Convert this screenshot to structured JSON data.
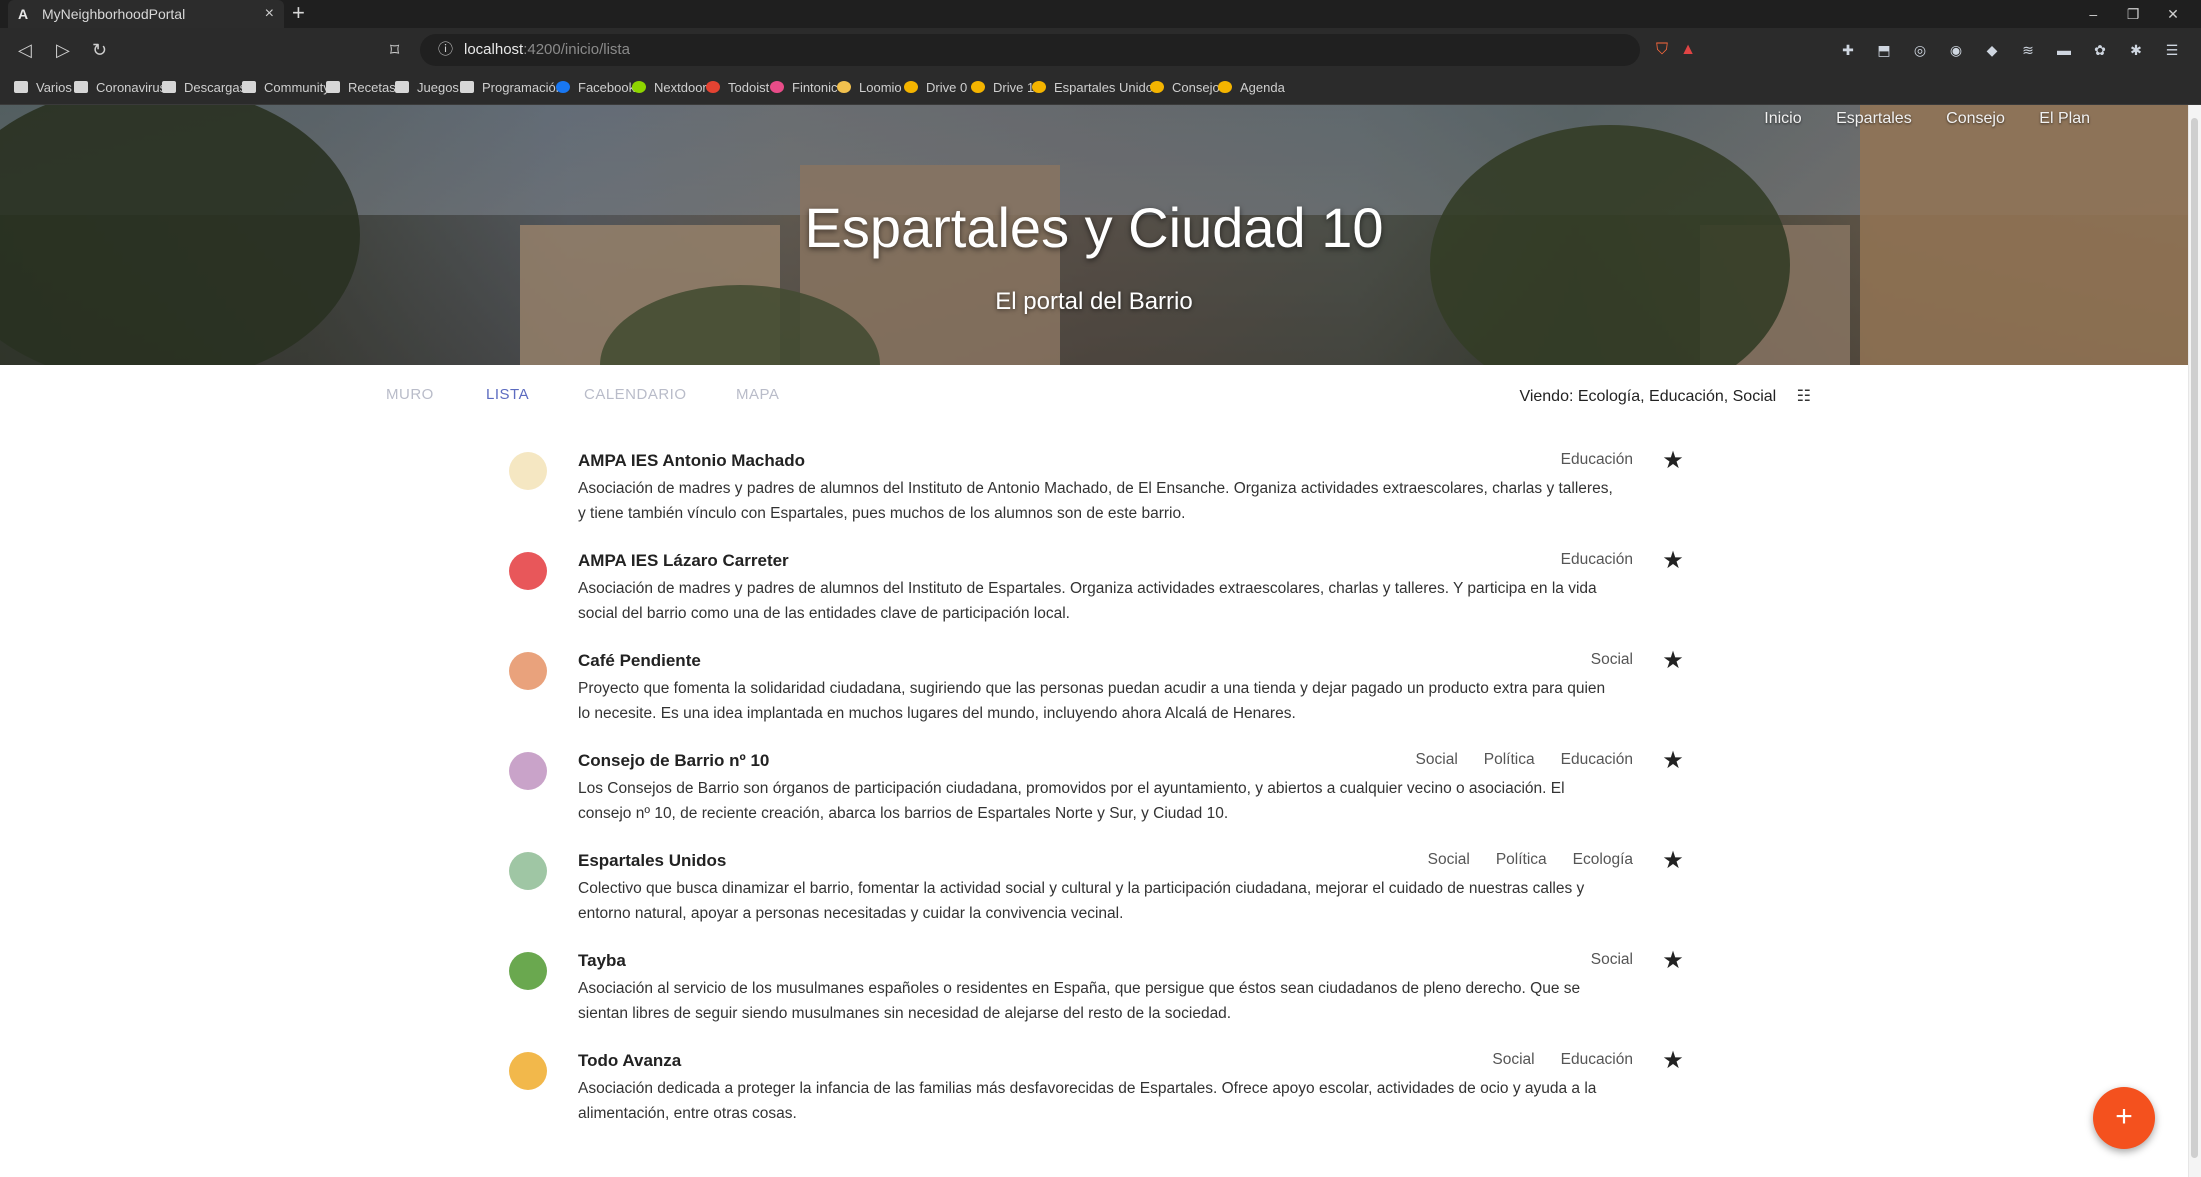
{
  "browser": {
    "tab_favicon": "A",
    "tab_title": "MyNeighborhoodPortal",
    "tab_close": "×",
    "new_tab": "+",
    "window_controls": [
      "–",
      "❐",
      "✕"
    ],
    "url_host": "localhost",
    "url_path": ":4200/inicio/lista",
    "extensions": [
      "✚",
      "⬒",
      "◎",
      "◉",
      "◆",
      "≋",
      "▬",
      "✿",
      "✱",
      "☰"
    ],
    "bookmarks": [
      {
        "label": "Varios",
        "icon": "folder-icon"
      },
      {
        "label": "Coronavirus",
        "icon": "folder-icon"
      },
      {
        "label": "Descargas",
        "icon": "folder-icon"
      },
      {
        "label": "Community",
        "icon": "folder-icon"
      },
      {
        "label": "Recetas",
        "icon": "folder-icon"
      },
      {
        "label": "Juegos",
        "icon": "folder-icon"
      },
      {
        "label": "Programación",
        "icon": "folder-icon"
      },
      {
        "label": "Facebook",
        "icon": "facebook-icon"
      },
      {
        "label": "Nextdoor",
        "icon": "nextdoor-icon"
      },
      {
        "label": "Todoist",
        "icon": "todoist-icon"
      },
      {
        "label": "Fintonic",
        "icon": "fintonic-icon"
      },
      {
        "label": "Loomio",
        "icon": "loomio-icon"
      },
      {
        "label": "Drive 0",
        "icon": "drive-icon"
      },
      {
        "label": "Drive 1",
        "icon": "drive-icon"
      },
      {
        "label": "Espartales Unidos",
        "icon": "drive-icon"
      },
      {
        "label": "Consejo",
        "icon": "drive-icon"
      },
      {
        "label": "Agenda",
        "icon": "drive-icon"
      }
    ]
  },
  "site": {
    "nav": [
      "Inicio",
      "Espartales",
      "Consejo",
      "El Plan"
    ],
    "title": "Espartales y Ciudad 10",
    "subtitle": "El portal del Barrio"
  },
  "view_tabs": [
    {
      "label": "MURO",
      "active": false
    },
    {
      "label": "LISTA",
      "active": true
    },
    {
      "label": "CALENDARIO",
      "active": false
    },
    {
      "label": "MAPA",
      "active": false
    }
  ],
  "filter_text": "Viendo: Ecología, Educación, Social",
  "entities": [
    {
      "name": "AMPA IES Antonio Machado",
      "description": "Asociación de madres y padres de alumnos del Instituto de Antonio Machado, de El Ensanche. Organiza actividades extraescolares, charlas y talleres, y tiene también vínculo con Espartales, pues muchos de los alumnos son de este barrio.",
      "tags": [
        "Educación"
      ],
      "logo_color": "#f5e7c2"
    },
    {
      "name": "AMPA IES Lázaro Carreter",
      "description": "Asociación de madres y padres de alumnos del Instituto de Espartales. Organiza actividades extraescolares, charlas y talleres. Y participa en la vida social del barrio como una de las entidades clave de participación local.",
      "tags": [
        "Educación"
      ],
      "logo_color": "#e8575a"
    },
    {
      "name": "Café Pendiente",
      "description": "Proyecto que fomenta la solidaridad ciudadana, sugiriendo que las personas puedan acudir a una tienda y dejar pagado un producto extra para quien lo necesite. Es una idea implantada en muchos lugares del mundo, incluyendo ahora Alcalá de Henares.",
      "tags": [
        "Social"
      ],
      "logo_color": "#e9a27c"
    },
    {
      "name": "Consejo de Barrio nº 10",
      "description": "Los Consejos de Barrio son órganos de participación ciudadana, promovidos por el ayuntamiento, y abiertos a cualquier vecino o asociación. El consejo nº 10, de reciente creación, abarca los barrios de Espartales Norte y Sur, y Ciudad 10.",
      "tags": [
        "Social",
        "Política",
        "Educación"
      ],
      "logo_color": "#c9a3c9"
    },
    {
      "name": "Espartales Unidos",
      "description": "Colectivo que busca dinamizar el barrio, fomentar la actividad social y cultural y la participación ciudadana, mejorar el cuidado de nuestras calles y entorno natural, apoyar a personas necesitadas y cuidar la convivencia vecinal.",
      "tags": [
        "Social",
        "Política",
        "Ecología"
      ],
      "logo_color": "#9fc6a4"
    },
    {
      "name": "Tayba",
      "description": "Asociación al servicio de los musulmanes españoles o residentes en España, que persigue que éstos sean ciudadanos de pleno derecho. Que se sientan libres de seguir siendo musulmanes sin necesidad de alejarse del resto de la sociedad.",
      "tags": [
        "Social"
      ],
      "logo_color": "#6aa84f"
    },
    {
      "name": "Todo Avanza",
      "description": "Asociación dedicada a proteger la infancia de las familias más desfavorecidas de Espartales. Ofrece apoyo escolar, actividades de ocio y ayuda a la alimentación, entre otras cosas.",
      "tags": [
        "Social",
        "Educación"
      ],
      "logo_color": "#f2b84b"
    }
  ],
  "star_glyph": "★",
  "fab_label": "+",
  "colors": {
    "accent": "#5c6bc0",
    "fab": "#f4511e"
  }
}
